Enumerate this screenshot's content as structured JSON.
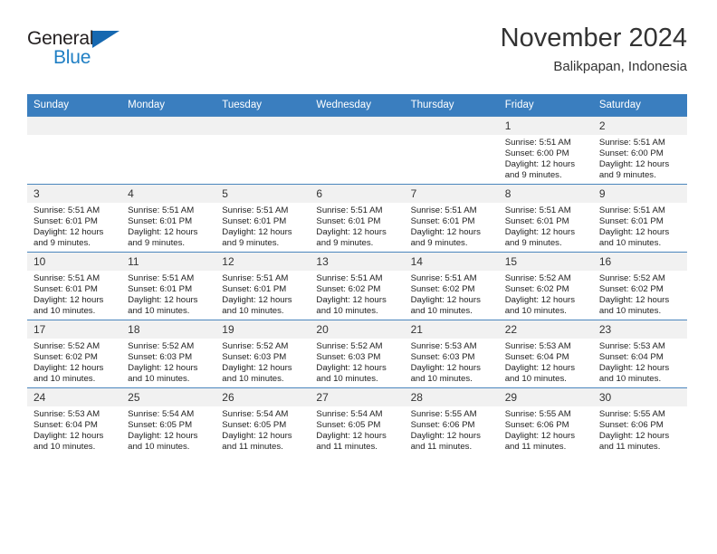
{
  "brand": {
    "name_part1": "General",
    "name_part2": "Blue",
    "accent_color": "#1f7fc4",
    "triangle_color": "#1668b0"
  },
  "header": {
    "month_title": "November 2024",
    "location": "Balikpapan, Indonesia"
  },
  "theme": {
    "header_bg": "#3a7ebf",
    "daynum_bg": "#f1f1f1",
    "page_bg": "#ffffff"
  },
  "weekday_headers": [
    "Sunday",
    "Monday",
    "Tuesday",
    "Wednesday",
    "Thursday",
    "Friday",
    "Saturday"
  ],
  "labels": {
    "sunrise_prefix": "Sunrise:",
    "sunset_prefix": "Sunset:",
    "daylight_prefix": "Daylight:"
  },
  "weeks": [
    [
      {
        "day": "",
        "sunrise": "",
        "sunset": "",
        "daylight": "",
        "empty": true
      },
      {
        "day": "",
        "sunrise": "",
        "sunset": "",
        "daylight": "",
        "empty": true
      },
      {
        "day": "",
        "sunrise": "",
        "sunset": "",
        "daylight": "",
        "empty": true
      },
      {
        "day": "",
        "sunrise": "",
        "sunset": "",
        "daylight": "",
        "empty": true
      },
      {
        "day": "",
        "sunrise": "",
        "sunset": "",
        "daylight": "",
        "empty": true
      },
      {
        "day": "1",
        "sunrise": "Sunrise: 5:51 AM",
        "sunset": "Sunset: 6:00 PM",
        "daylight": "Daylight: 12 hours and 9 minutes.",
        "empty": false
      },
      {
        "day": "2",
        "sunrise": "Sunrise: 5:51 AM",
        "sunset": "Sunset: 6:00 PM",
        "daylight": "Daylight: 12 hours and 9 minutes.",
        "empty": false
      }
    ],
    [
      {
        "day": "3",
        "sunrise": "Sunrise: 5:51 AM",
        "sunset": "Sunset: 6:01 PM",
        "daylight": "Daylight: 12 hours and 9 minutes.",
        "empty": false
      },
      {
        "day": "4",
        "sunrise": "Sunrise: 5:51 AM",
        "sunset": "Sunset: 6:01 PM",
        "daylight": "Daylight: 12 hours and 9 minutes.",
        "empty": false
      },
      {
        "day": "5",
        "sunrise": "Sunrise: 5:51 AM",
        "sunset": "Sunset: 6:01 PM",
        "daylight": "Daylight: 12 hours and 9 minutes.",
        "empty": false
      },
      {
        "day": "6",
        "sunrise": "Sunrise: 5:51 AM",
        "sunset": "Sunset: 6:01 PM",
        "daylight": "Daylight: 12 hours and 9 minutes.",
        "empty": false
      },
      {
        "day": "7",
        "sunrise": "Sunrise: 5:51 AM",
        "sunset": "Sunset: 6:01 PM",
        "daylight": "Daylight: 12 hours and 9 minutes.",
        "empty": false
      },
      {
        "day": "8",
        "sunrise": "Sunrise: 5:51 AM",
        "sunset": "Sunset: 6:01 PM",
        "daylight": "Daylight: 12 hours and 9 minutes.",
        "empty": false
      },
      {
        "day": "9",
        "sunrise": "Sunrise: 5:51 AM",
        "sunset": "Sunset: 6:01 PM",
        "daylight": "Daylight: 12 hours and 10 minutes.",
        "empty": false
      }
    ],
    [
      {
        "day": "10",
        "sunrise": "Sunrise: 5:51 AM",
        "sunset": "Sunset: 6:01 PM",
        "daylight": "Daylight: 12 hours and 10 minutes.",
        "empty": false
      },
      {
        "day": "11",
        "sunrise": "Sunrise: 5:51 AM",
        "sunset": "Sunset: 6:01 PM",
        "daylight": "Daylight: 12 hours and 10 minutes.",
        "empty": false
      },
      {
        "day": "12",
        "sunrise": "Sunrise: 5:51 AM",
        "sunset": "Sunset: 6:01 PM",
        "daylight": "Daylight: 12 hours and 10 minutes.",
        "empty": false
      },
      {
        "day": "13",
        "sunrise": "Sunrise: 5:51 AM",
        "sunset": "Sunset: 6:02 PM",
        "daylight": "Daylight: 12 hours and 10 minutes.",
        "empty": false
      },
      {
        "day": "14",
        "sunrise": "Sunrise: 5:51 AM",
        "sunset": "Sunset: 6:02 PM",
        "daylight": "Daylight: 12 hours and 10 minutes.",
        "empty": false
      },
      {
        "day": "15",
        "sunrise": "Sunrise: 5:52 AM",
        "sunset": "Sunset: 6:02 PM",
        "daylight": "Daylight: 12 hours and 10 minutes.",
        "empty": false
      },
      {
        "day": "16",
        "sunrise": "Sunrise: 5:52 AM",
        "sunset": "Sunset: 6:02 PM",
        "daylight": "Daylight: 12 hours and 10 minutes.",
        "empty": false
      }
    ],
    [
      {
        "day": "17",
        "sunrise": "Sunrise: 5:52 AM",
        "sunset": "Sunset: 6:02 PM",
        "daylight": "Daylight: 12 hours and 10 minutes.",
        "empty": false
      },
      {
        "day": "18",
        "sunrise": "Sunrise: 5:52 AM",
        "sunset": "Sunset: 6:03 PM",
        "daylight": "Daylight: 12 hours and 10 minutes.",
        "empty": false
      },
      {
        "day": "19",
        "sunrise": "Sunrise: 5:52 AM",
        "sunset": "Sunset: 6:03 PM",
        "daylight": "Daylight: 12 hours and 10 minutes.",
        "empty": false
      },
      {
        "day": "20",
        "sunrise": "Sunrise: 5:52 AM",
        "sunset": "Sunset: 6:03 PM",
        "daylight": "Daylight: 12 hours and 10 minutes.",
        "empty": false
      },
      {
        "day": "21",
        "sunrise": "Sunrise: 5:53 AM",
        "sunset": "Sunset: 6:03 PM",
        "daylight": "Daylight: 12 hours and 10 minutes.",
        "empty": false
      },
      {
        "day": "22",
        "sunrise": "Sunrise: 5:53 AM",
        "sunset": "Sunset: 6:04 PM",
        "daylight": "Daylight: 12 hours and 10 minutes.",
        "empty": false
      },
      {
        "day": "23",
        "sunrise": "Sunrise: 5:53 AM",
        "sunset": "Sunset: 6:04 PM",
        "daylight": "Daylight: 12 hours and 10 minutes.",
        "empty": false
      }
    ],
    [
      {
        "day": "24",
        "sunrise": "Sunrise: 5:53 AM",
        "sunset": "Sunset: 6:04 PM",
        "daylight": "Daylight: 12 hours and 10 minutes.",
        "empty": false
      },
      {
        "day": "25",
        "sunrise": "Sunrise: 5:54 AM",
        "sunset": "Sunset: 6:05 PM",
        "daylight": "Daylight: 12 hours and 10 minutes.",
        "empty": false
      },
      {
        "day": "26",
        "sunrise": "Sunrise: 5:54 AM",
        "sunset": "Sunset: 6:05 PM",
        "daylight": "Daylight: 12 hours and 11 minutes.",
        "empty": false
      },
      {
        "day": "27",
        "sunrise": "Sunrise: 5:54 AM",
        "sunset": "Sunset: 6:05 PM",
        "daylight": "Daylight: 12 hours and 11 minutes.",
        "empty": false
      },
      {
        "day": "28",
        "sunrise": "Sunrise: 5:55 AM",
        "sunset": "Sunset: 6:06 PM",
        "daylight": "Daylight: 12 hours and 11 minutes.",
        "empty": false
      },
      {
        "day": "29",
        "sunrise": "Sunrise: 5:55 AM",
        "sunset": "Sunset: 6:06 PM",
        "daylight": "Daylight: 12 hours and 11 minutes.",
        "empty": false
      },
      {
        "day": "30",
        "sunrise": "Sunrise: 5:55 AM",
        "sunset": "Sunset: 6:06 PM",
        "daylight": "Daylight: 12 hours and 11 minutes.",
        "empty": false
      }
    ]
  ]
}
